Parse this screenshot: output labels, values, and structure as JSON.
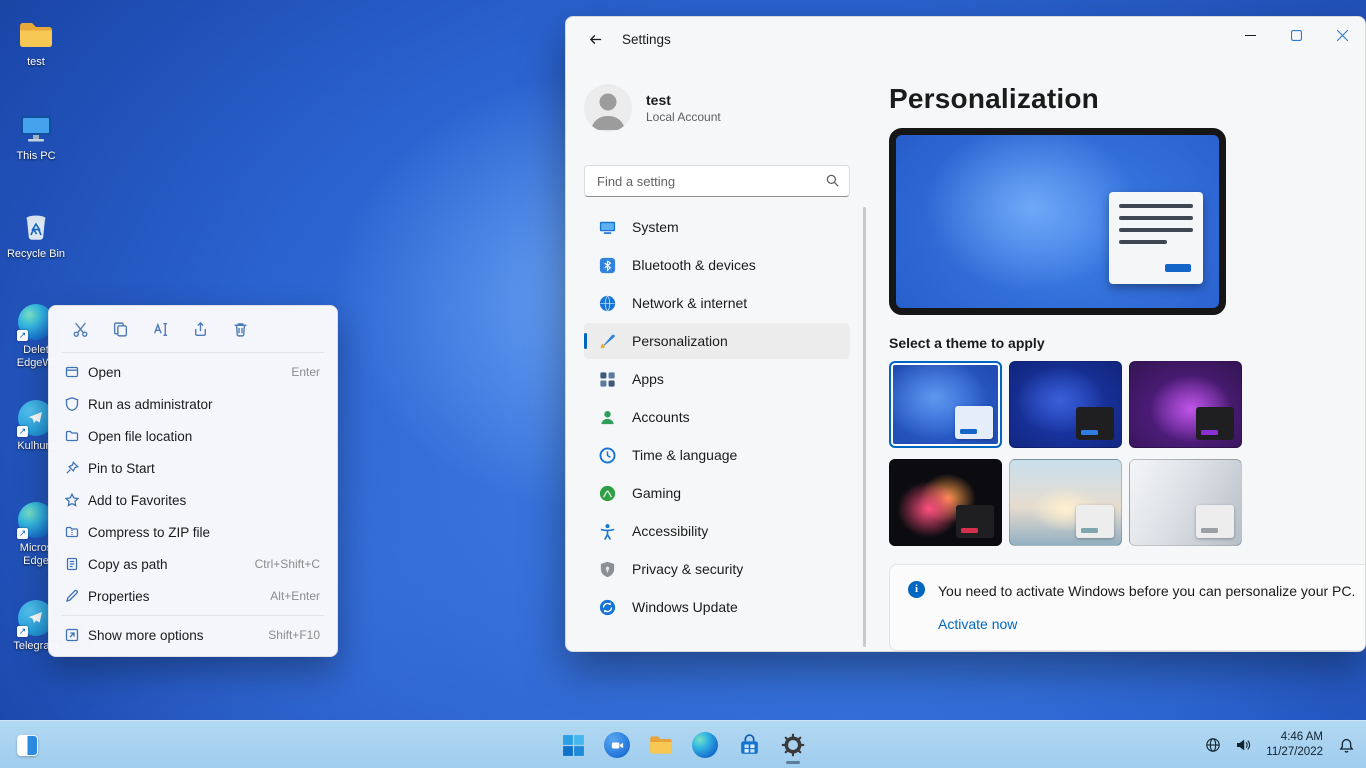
{
  "desktop": {
    "icons": [
      {
        "label": "test"
      },
      {
        "label": "This PC"
      },
      {
        "label": "Recycle Bin"
      },
      {
        "label": "Delet\nEdgeWi"
      },
      {
        "label": "Kulhunt"
      },
      {
        "label": "Micros\nEdge"
      },
      {
        "label": "Telegram"
      }
    ]
  },
  "context_menu": {
    "quick_actions": [
      "cut",
      "copy",
      "rename",
      "share",
      "delete"
    ],
    "items": [
      {
        "label": "Open",
        "shortcut": "Enter"
      },
      {
        "label": "Run as administrator",
        "shortcut": ""
      },
      {
        "label": "Open file location",
        "shortcut": ""
      },
      {
        "label": "Pin to Start",
        "shortcut": ""
      },
      {
        "label": "Add to Favorites",
        "shortcut": ""
      },
      {
        "label": "Compress to ZIP file",
        "shortcut": ""
      },
      {
        "label": "Copy as path",
        "shortcut": "Ctrl+Shift+C"
      },
      {
        "label": "Properties",
        "shortcut": "Alt+Enter"
      }
    ],
    "show_more": {
      "label": "Show more options",
      "shortcut": "Shift+F10"
    }
  },
  "settings": {
    "window_title": "Settings",
    "user": {
      "name": "test",
      "account_type": "Local Account"
    },
    "search_placeholder": "Find a setting",
    "nav": [
      {
        "label": "System"
      },
      {
        "label": "Bluetooth & devices"
      },
      {
        "label": "Network & internet"
      },
      {
        "label": "Personalization"
      },
      {
        "label": "Apps"
      },
      {
        "label": "Accounts"
      },
      {
        "label": "Time & language"
      },
      {
        "label": "Gaming"
      },
      {
        "label": "Accessibility"
      },
      {
        "label": "Privacy & security"
      },
      {
        "label": "Windows Update"
      }
    ],
    "selected_nav": "Personalization",
    "page": {
      "title": "Personalization",
      "theme_label": "Select a theme to apply",
      "selected_theme_index": 0,
      "banner_text": "You need to activate Windows before you can personalize your PC.",
      "banner_action": "Activate now"
    }
  },
  "taskbar": {
    "time": "4:46 AM",
    "date": "11/27/2022",
    "accent_color": "#0067c0"
  }
}
